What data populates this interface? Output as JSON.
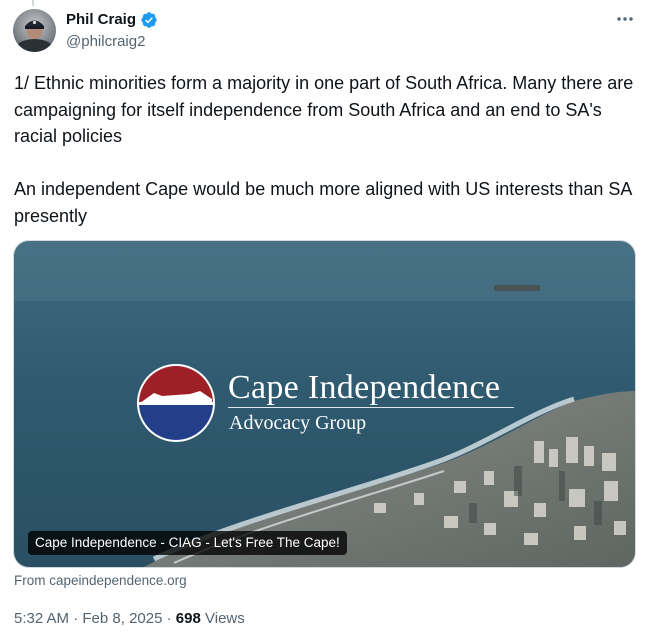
{
  "author": {
    "display_name": "Phil Craig",
    "handle": "@philcraig2",
    "verified_badge_icon": "verified-badge-icon",
    "verified_color": "#1d9bf0"
  },
  "more_icon": "more-horizontal-icon",
  "tweet": {
    "text": "1/ Ethnic minorities form a majority in one part of South Africa. Many there are campaigning for itself independence from South Africa and an end to SA's racial policies\n\nAn independent Cape would be much more aligned with US interests than SA presently"
  },
  "card": {
    "logo_title": "Cape Independence",
    "logo_subtitle": "Advocacy Group",
    "logo_colors": {
      "top": "#9c2026",
      "bottom": "#243f8a"
    },
    "caption": "Cape Independence - CIAG - Let's Free The Cape!",
    "source": "From capeindependence.org"
  },
  "meta": {
    "time": "5:32 AM",
    "separator": "·",
    "date": "Feb 8, 2025",
    "views_count": "698",
    "views_label": "Views"
  },
  "colors": {
    "text_primary": "#0f1419",
    "text_secondary": "#536471",
    "border": "#cfd9de"
  }
}
